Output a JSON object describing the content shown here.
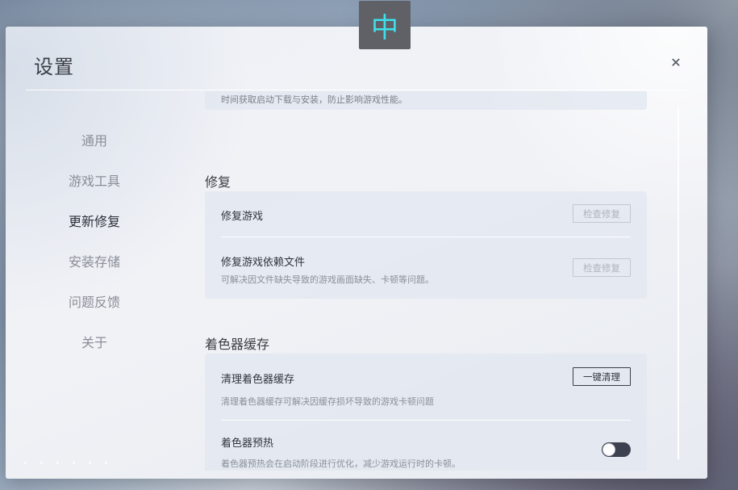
{
  "dialog": {
    "title": "设置",
    "ime_indicator": "中",
    "close_icon_glyph": "✕"
  },
  "nav": {
    "items": [
      {
        "label": "通用",
        "active": false
      },
      {
        "label": "游戏工具",
        "active": false
      },
      {
        "label": "更新修复",
        "active": true
      },
      {
        "label": "安装存储",
        "active": false
      },
      {
        "label": "问题反馈",
        "active": false
      },
      {
        "label": "关于",
        "active": false
      }
    ]
  },
  "content": {
    "cut_off_text": "时间获取启动下载与安装，防止影响游戏性能。",
    "repair": {
      "title": "修复",
      "rows": [
        {
          "title": "修复游戏",
          "desc": "",
          "button": "检查修复"
        },
        {
          "title": "修复游戏依赖文件",
          "desc": "可解决因文件缺失导致的游戏画面缺失、卡顿等问题。",
          "button": "检查修复"
        }
      ]
    },
    "shader": {
      "title": "着色器缓存",
      "clear_row": {
        "title": "清理着色器缓存",
        "desc": "清理着色器缓存可解决因缓存损坏导致的游戏卡顿问题",
        "button": "一键清理"
      },
      "preheat_row": {
        "title": "着色器预热",
        "desc": "着色器预热会在启动阶段进行优化，减少游戏运行时的卡顿。",
        "toggle_on": false
      }
    }
  },
  "colors": {
    "accent_dark": "#3d4150",
    "ime_text": "#3ee0ea",
    "ime_bg": "#5f6167"
  }
}
